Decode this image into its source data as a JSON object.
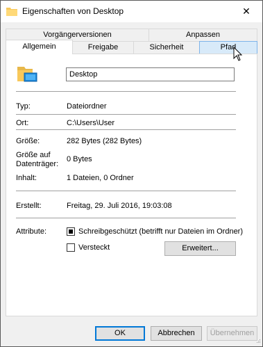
{
  "window": {
    "title": "Eigenschaften von Desktop",
    "close_glyph": "✕"
  },
  "tabs_row1": [
    {
      "label": "Vorgängerversionen"
    },
    {
      "label": "Anpassen"
    }
  ],
  "tabs_row2": [
    {
      "label": "Allgemein",
      "active": true
    },
    {
      "label": "Freigabe"
    },
    {
      "label": "Sicherheit"
    },
    {
      "label": "Pfad",
      "hover": true
    }
  ],
  "general": {
    "name_value": "Desktop",
    "type_label": "Typ:",
    "type_value": "Dateiordner",
    "location_label": "Ort:",
    "location_value": "C:\\Users\\User",
    "size_label": "Größe:",
    "size_value": "282 Bytes (282 Bytes)",
    "disk_size_label_1": "Größe auf",
    "disk_size_label_2": "Datenträger:",
    "disk_size_value": "0 Bytes",
    "contents_label": "Inhalt:",
    "contents_value": "1 Dateien, 0 Ordner",
    "created_label": "Erstellt:",
    "created_value": "Freitag, 29. Juli 2016, 19:03:08",
    "attributes_label": "Attribute:",
    "readonly_label": "Schreibgeschützt (betrifft nur Dateien im Ordner)",
    "readonly_state": "indeterminate",
    "hidden_label": "Versteckt",
    "hidden_state": "unchecked",
    "advanced_button": "Erweitert..."
  },
  "footer": {
    "ok": "OK",
    "cancel": "Abbrechen",
    "apply": "Übernehmen"
  },
  "colors": {
    "folder": "#f8c85a",
    "accent": "#0078d7"
  }
}
